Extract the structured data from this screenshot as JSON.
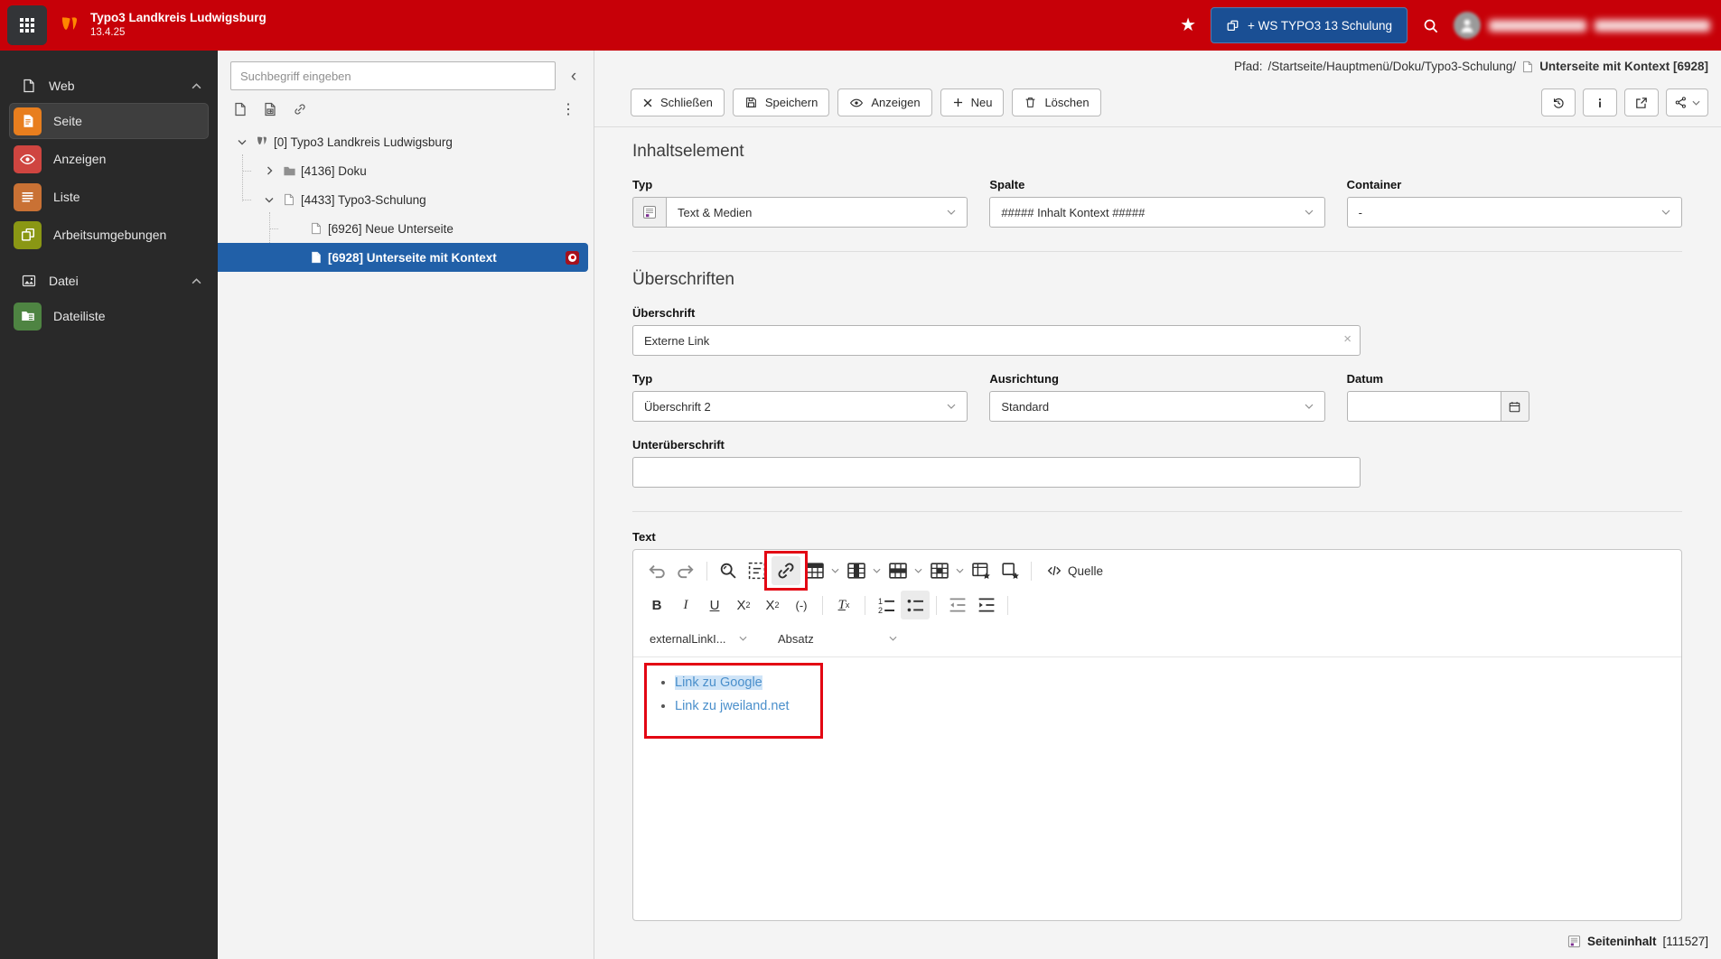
{
  "colors": {
    "topbar_red": "#c70008",
    "workspace_button_blue": "#1a4f94",
    "tree_selection_blue": "#2160a8",
    "annotation_red": "#e30613",
    "link_blue": "#4a8fcb",
    "module_icon_seite": "#e87e1e",
    "module_icon_anzeigen": "#cf4540",
    "module_icon_liste": "#c97134",
    "module_icon_arbeitsumgebungen": "#8a9714",
    "module_icon_dateiliste": "#4e8442"
  },
  "topbar": {
    "site_title": "Typo3 Landkreis Ludwigsburg",
    "version": "13.4.25",
    "workspace_button": "+ WS TYPO3 13 Schulung"
  },
  "module_menu": {
    "groups": [
      {
        "label": "Web",
        "items": [
          {
            "label": "Seite",
            "active": true
          },
          {
            "label": "Anzeigen"
          },
          {
            "label": "Liste"
          },
          {
            "label": "Arbeitsumgebungen"
          }
        ]
      },
      {
        "label": "Datei",
        "items": [
          {
            "label": "Dateiliste"
          }
        ]
      }
    ]
  },
  "pagetree": {
    "search_placeholder": "Suchbegriff eingeben",
    "nodes": [
      {
        "label": "[0] Typo3 Landkreis Ludwigsburg",
        "depth": 0,
        "expanded": true
      },
      {
        "label": "[4136] Doku",
        "depth": 1,
        "collapsed": true
      },
      {
        "label": "[4433] Typo3-Schulung",
        "depth": 1,
        "expanded": true
      },
      {
        "label": "[6926] Neue Unterseite",
        "depth": 2
      },
      {
        "label": "[6928] Unterseite mit Kontext",
        "depth": 2,
        "selected": true
      }
    ]
  },
  "docheader": {
    "path_label": "Pfad:",
    "path": "/Startseite/Hauptmenü/Doku/Typo3-Schulung/",
    "record_title": "Unterseite mit Kontext [6928]",
    "buttons": {
      "close": "Schließen",
      "save": "Speichern",
      "view": "Anzeigen",
      "new": "Neu",
      "delete": "Löschen"
    }
  },
  "form": {
    "inhaltselement": {
      "heading": "Inhaltselement",
      "typ_label": "Typ",
      "typ_value": "Text & Medien",
      "spalte_label": "Spalte",
      "spalte_value": "##### Inhalt Kontext #####",
      "container_label": "Container",
      "container_value": "-"
    },
    "ueberschriften": {
      "heading": "Überschriften",
      "ueberschrift_label": "Überschrift",
      "ueberschrift_value": "Externe Link",
      "typ_label": "Typ",
      "typ_value": "Überschrift 2",
      "ausrichtung_label": "Ausrichtung",
      "ausrichtung_value": "Standard",
      "datum_label": "Datum",
      "unterueberschrift_label": "Unterüberschrift"
    },
    "text": {
      "label": "Text"
    }
  },
  "rte": {
    "buttons": {
      "bold": "B",
      "italic": "I",
      "underline": "U",
      "sub_base": "X",
      "sub_small": "2",
      "sup_base": "X",
      "sup_small": "2",
      "soft_hyphen": "(-)",
      "removeformat_base": "T",
      "removeformat_small": "x"
    },
    "source_label": "Quelle",
    "style_value": "externalLinkI...",
    "block_value": "Absatz",
    "content_links": [
      {
        "text": "Link zu Google"
      },
      {
        "text": "Link zu jweiland.net"
      }
    ]
  },
  "footer": {
    "record_type": "Seiteninhalt",
    "record_uid": "[111527]"
  }
}
